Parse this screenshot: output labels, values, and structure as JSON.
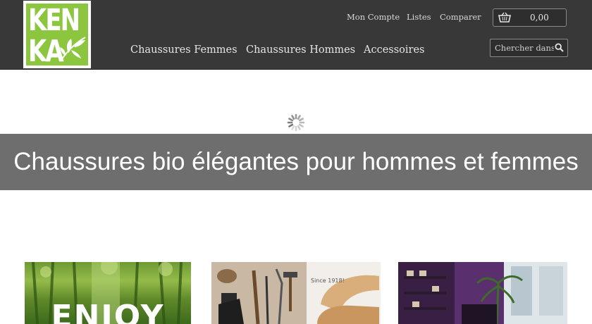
{
  "header": {
    "logo": {
      "text_line1": "KEN",
      "text_line2": "KA"
    },
    "top_links": [
      "Mon Compte",
      "Listes",
      "Comparer"
    ],
    "cart": {
      "amount": "0,00",
      "icon": "basket-icon"
    },
    "nav": [
      "Chaussures Femmes",
      "Chaussures Hommes",
      "Accessoires"
    ],
    "search": {
      "placeholder": "Chercher dans c",
      "icon": "search-icon"
    }
  },
  "slider": {
    "title": "Chaussures bio élégantes pour hommes et femmes",
    "spinner_icon": "loading-spinner-icon"
  },
  "cards": [
    {
      "image": "bamboo-forest-image",
      "caption": "ENJOY"
    },
    {
      "image": "shoemaking-tools-image",
      "caption": "Since 1918!"
    },
    {
      "image": "shoe-store-interior-image"
    }
  ],
  "colors": {
    "header_bg": "#383838",
    "logo_green": "#8cc63f",
    "banner_bg": "#6e6e6e"
  }
}
